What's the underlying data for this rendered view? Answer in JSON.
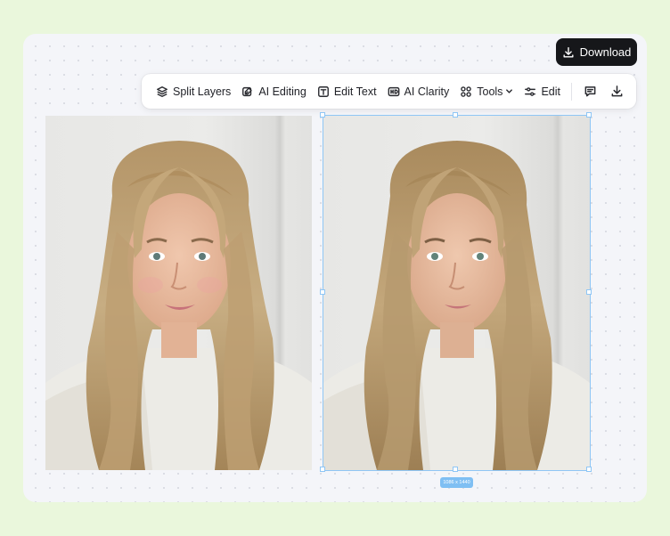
{
  "header": {
    "download_label": "Download"
  },
  "toolbar": {
    "items": [
      {
        "label": "Split Layers",
        "icon": "layers-icon"
      },
      {
        "label": "AI Editing",
        "icon": "ai-edit-icon"
      },
      {
        "label": "Edit Text",
        "icon": "text-icon"
      },
      {
        "label": "AI Clarity",
        "icon": "hd-icon"
      },
      {
        "label": "Tools",
        "icon": "grid-icon"
      },
      {
        "label": "Edit",
        "icon": "sliders-icon"
      }
    ],
    "comment_icon": "comment-icon",
    "download_icon": "download-icon"
  },
  "canvas": {
    "images": [
      {
        "name": "original-photo"
      },
      {
        "name": "edited-photo",
        "selected": true
      }
    ],
    "selection_size_label": "1086 x 1440"
  },
  "colors": {
    "background": "#eaf7dc",
    "canvas": "#f4f5f9",
    "download_button": "#16171a",
    "selection": "#8fc6f5"
  }
}
